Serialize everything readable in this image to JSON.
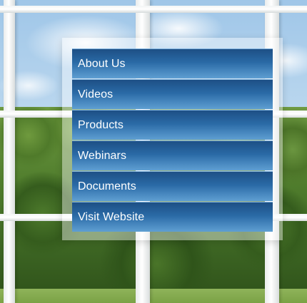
{
  "menu": {
    "items": [
      {
        "label": "About Us"
      },
      {
        "label": "Videos"
      },
      {
        "label": "Products"
      },
      {
        "label": "Webinars"
      },
      {
        "label": "Documents"
      },
      {
        "label": "Visit Website"
      }
    ]
  },
  "colors": {
    "menu_item_top": "#1d4f85",
    "menu_item_bottom": "#5f9fd2",
    "menu_text": "#ffffff",
    "frame": "#ffffff"
  }
}
